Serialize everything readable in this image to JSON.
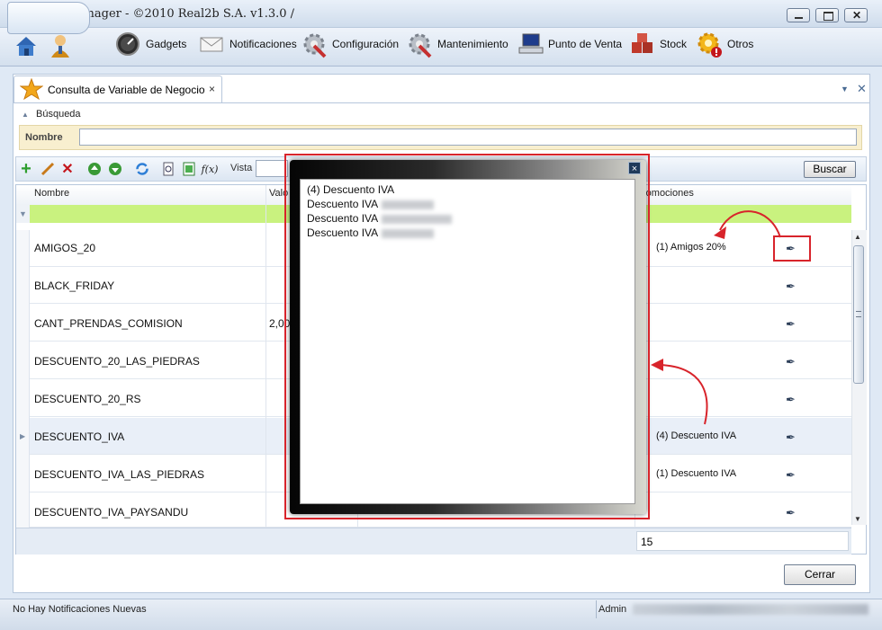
{
  "window": {
    "title": "I-Point Manager - ©2010 Real2b S.A. v1.3.0 /"
  },
  "menu": {
    "items": [
      {
        "label": "Gadgets",
        "icon": "gauge-icon"
      },
      {
        "label": "Notificaciones",
        "icon": "envelope-icon"
      },
      {
        "label": "Configuración",
        "icon": "gear-wrench-icon"
      },
      {
        "label": "Mantenimiento",
        "icon": "gear-wrench-icon"
      },
      {
        "label": "Punto de Venta",
        "icon": "computer-icon"
      },
      {
        "label": "Stock",
        "icon": "boxes-icon"
      },
      {
        "label": "Otros",
        "icon": "gear-warning-icon"
      }
    ]
  },
  "tab": {
    "label": "Consulta de Variable de Negocio",
    "close": "×"
  },
  "search": {
    "section_label": "Búsqueda",
    "nombre_label": "Nombre",
    "nombre_value": ""
  },
  "toolbar": {
    "vista_label": "Vista",
    "buscar_label": "Buscar"
  },
  "grid": {
    "headers": {
      "nombre": "Nombre",
      "valor": "Valo",
      "promociones": "romociones"
    },
    "rows": [
      {
        "nombre": "AMIGOS_20",
        "valor": "",
        "promociones": "(1) Amigos 20%"
      },
      {
        "nombre": "BLACK_FRIDAY",
        "valor": "",
        "promociones": ""
      },
      {
        "nombre": "CANT_PRENDAS_COMISION",
        "valor": "2,00",
        "promociones": ""
      },
      {
        "nombre": "DESCUENTO_20_LAS_PIEDRAS",
        "valor": "",
        "promociones": ""
      },
      {
        "nombre": "DESCUENTO_20_RS",
        "valor": "",
        "promociones": ""
      },
      {
        "nombre": "DESCUENTO_IVA",
        "valor": "",
        "promociones": "(4) Descuento IVA"
      },
      {
        "nombre": "DESCUENTO_IVA_LAS_PIEDRAS",
        "valor": "",
        "promociones": "(1) Descuento IVA"
      },
      {
        "nombre": "DESCUENTO_IVA_PAYSANDU",
        "valor": "",
        "promociones": ""
      }
    ],
    "count": "15"
  },
  "popup": {
    "lines": [
      "(4) Descuento IVA",
      "Descuento IVA",
      "Descuento IVA",
      "Descuento IVA"
    ],
    "close": "×"
  },
  "buttons": {
    "cerrar": "Cerrar"
  },
  "status": {
    "notifications": "No Hay Notificaciones Nuevas",
    "user": "Admin"
  },
  "colors": {
    "filter_row": "#c9f27f",
    "annotation": "#d8242b",
    "search_panel": "#f8efcf"
  }
}
